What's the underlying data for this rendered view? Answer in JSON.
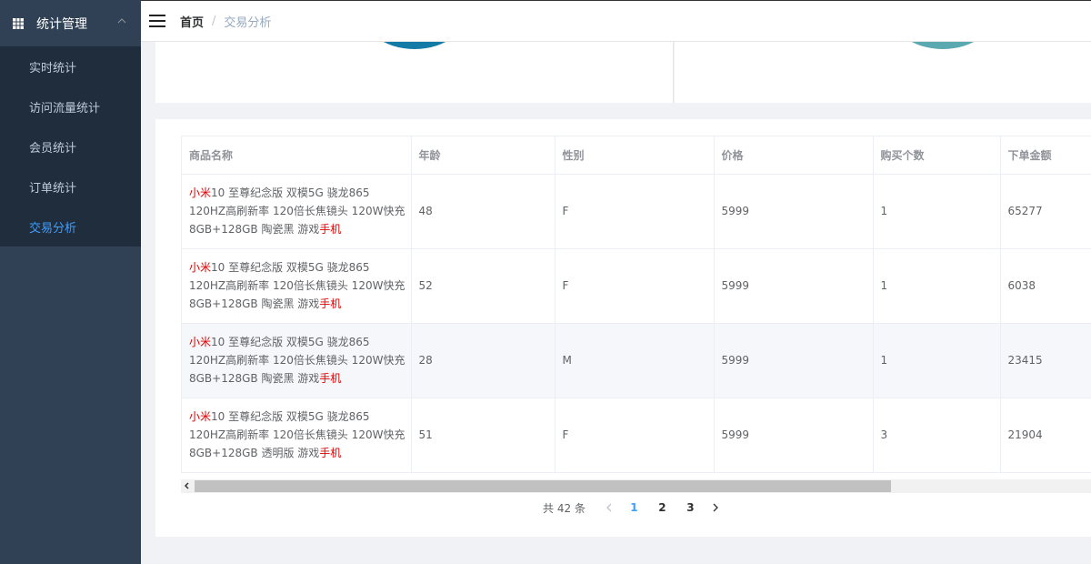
{
  "sidebar": {
    "group": {
      "label": "统计管理",
      "icon": "grid-icon",
      "expand_icon": "chevron-up-icon"
    },
    "items": [
      {
        "label": "实时统计"
      },
      {
        "label": "访问流量统计"
      },
      {
        "label": "会员统计"
      },
      {
        "label": "订单统计"
      },
      {
        "label": "交易分析"
      }
    ],
    "active_index": 4
  },
  "header": {
    "menu_icon": "hamburger-icon",
    "breadcrumb": {
      "home": "首页",
      "separator": "/",
      "current": "交易分析"
    }
  },
  "table": {
    "columns": [
      "商品名称",
      "年龄",
      "性别",
      "价格",
      "购买个数",
      "下单金额"
    ],
    "rows": [
      {
        "name_prefix": "小米",
        "name_middle": "10 至尊纪念版 双模5G 骁龙865 120HZ高刷新率 120倍长焦镜头 120W快充 8GB+128GB 陶瓷黑 游戏",
        "name_suffix": "手机",
        "age": "48",
        "gender": "F",
        "price": "5999",
        "count": "1",
        "amount": "65277"
      },
      {
        "name_prefix": "小米",
        "name_middle": "10 至尊纪念版 双模5G 骁龙865 120HZ高刷新率 120倍长焦镜头 120W快充 8GB+128GB 陶瓷黑 游戏",
        "name_suffix": "手机",
        "age": "52",
        "gender": "F",
        "price": "5999",
        "count": "1",
        "amount": "6038"
      },
      {
        "name_prefix": "小米",
        "name_middle": "10 至尊纪念版 双模5G 骁龙865 120HZ高刷新率 120倍长焦镜头 120W快充 8GB+128GB 陶瓷黑 游戏",
        "name_suffix": "手机",
        "age": "28",
        "gender": "M",
        "price": "5999",
        "count": "1",
        "amount": "23415"
      },
      {
        "name_prefix": "小米",
        "name_middle": "10 至尊纪念版 双模5G 骁龙865 120HZ高刷新率 120倍长焦镜头 120W快充 8GB+128GB 透明版 游戏",
        "name_suffix": "手机",
        "age": "51",
        "gender": "F",
        "price": "5999",
        "count": "3",
        "amount": "21904"
      }
    ]
  },
  "pagination": {
    "total_text": "共 42 条",
    "pages": [
      "1",
      "2",
      "3"
    ],
    "current": "1",
    "prev_icon": "chevron-left-icon",
    "next_icon": "chevron-right-icon"
  },
  "colors": {
    "sidebar_bg": "#304156",
    "submenu_bg": "#1f2d3d",
    "accent": "#409eff",
    "highlight": "#e00000",
    "donut_left": "#137ba6",
    "donut_right": "#5aa8b0"
  }
}
